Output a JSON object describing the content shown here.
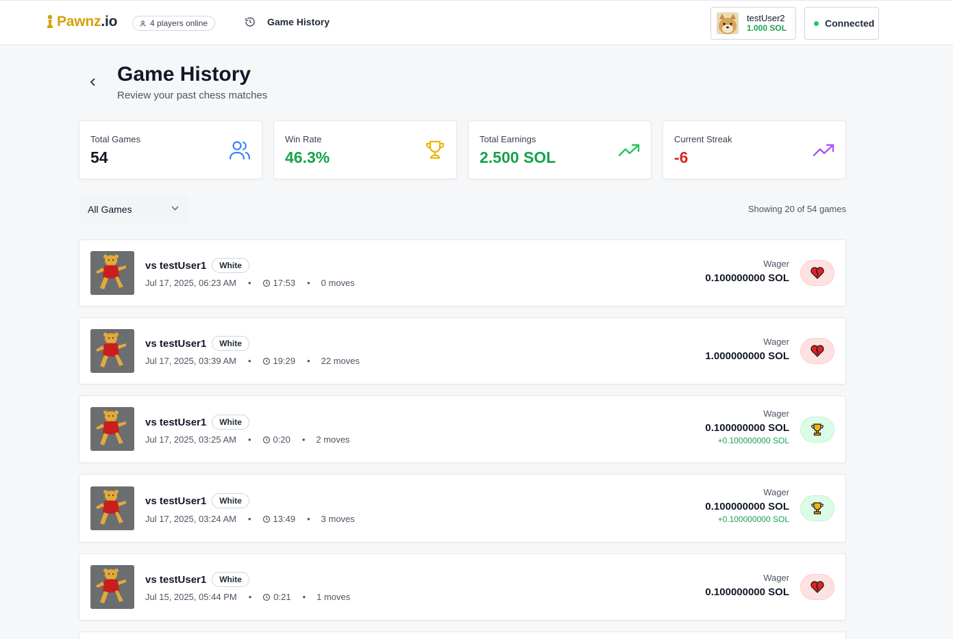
{
  "header": {
    "logo_main": "Pawnz",
    "logo_suffix": ".io",
    "online": "4 players online",
    "nav_history": "Game History",
    "user": {
      "name": "testUser2",
      "balance": "1.000 SOL"
    },
    "status": "Connected"
  },
  "page": {
    "title": "Game History",
    "subtitle": "Review your past chess matches"
  },
  "stats": [
    {
      "label": "Total Games",
      "value": "54",
      "color": "#111827",
      "icon": "users-icon"
    },
    {
      "label": "Win Rate",
      "value": "46.3%",
      "color": "#16a34a",
      "icon": "trophy-icon"
    },
    {
      "label": "Total Earnings",
      "value": "2.500 SOL",
      "color": "#16a34a",
      "icon": "trending-up-icon"
    },
    {
      "label": "Current Streak",
      "value": "-6",
      "color": "#dc2626",
      "icon": "trending-up-icon"
    }
  ],
  "filter": {
    "selected": "All Games"
  },
  "showing": "Showing 20 of 54 games",
  "games": [
    {
      "opponent": "vs testUser1",
      "color": "White",
      "date": "Jul 17, 2025, 06:23 AM",
      "duration": "17:53",
      "moves": "0 moves",
      "wager_label": "Wager",
      "wager": "0.100000000 SOL",
      "gain": "",
      "result": "loss"
    },
    {
      "opponent": "vs testUser1",
      "color": "White",
      "date": "Jul 17, 2025, 03:39 AM",
      "duration": "19:29",
      "moves": "22 moves",
      "wager_label": "Wager",
      "wager": "1.000000000 SOL",
      "gain": "",
      "result": "loss"
    },
    {
      "opponent": "vs testUser1",
      "color": "White",
      "date": "Jul 17, 2025, 03:25 AM",
      "duration": "0:20",
      "moves": "2 moves",
      "wager_label": "Wager",
      "wager": "0.100000000 SOL",
      "gain": "+0.100000000 SOL",
      "result": "win"
    },
    {
      "opponent": "vs testUser1",
      "color": "White",
      "date": "Jul 17, 2025, 03:24 AM",
      "duration": "13:49",
      "moves": "3 moves",
      "wager_label": "Wager",
      "wager": "0.100000000 SOL",
      "gain": "+0.100000000 SOL",
      "result": "win"
    },
    {
      "opponent": "vs testUser1",
      "color": "White",
      "date": "Jul 15, 2025, 05:44 PM",
      "duration": "0:21",
      "moves": "1 moves",
      "wager_label": "Wager",
      "wager": "0.100000000 SOL",
      "gain": "",
      "result": "loss"
    }
  ]
}
